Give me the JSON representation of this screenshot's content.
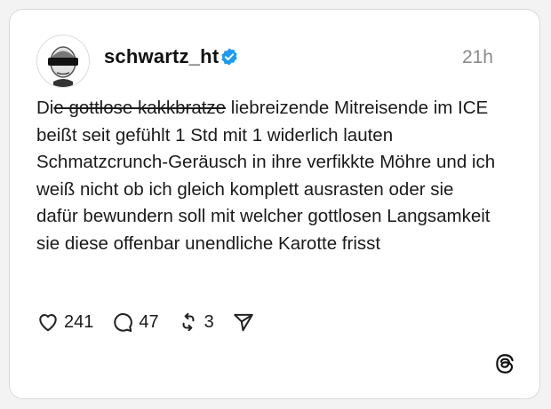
{
  "post": {
    "username": "schwartz_ht",
    "timestamp": "21h",
    "text_start": "Di",
    "text_struck": "e gottlose kakkbratze",
    "text_rest": " liebreizende Mitreisende im ICE beißt seit gefühlt 1 Std mit 1 widerlich lauten Schmatzcrunch-Geräusch in ihre verfikkte Möhre und ich weiß nicht ob ich gleich komplett ausrasten oder sie dafür bewundern soll mit welcher gottlosen Langsamkeit sie diese offenbar unendliche Karotte frisst"
  },
  "actions": {
    "likes": "241",
    "replies": "47",
    "reposts": "3"
  },
  "icons": {
    "verified": "verified-badge-icon",
    "like": "heart-icon",
    "reply": "comment-bubble-icon",
    "repost": "repost-icon",
    "share": "send-icon",
    "brand": "threads-logo-icon"
  },
  "colors": {
    "verified_blue": "#1d9bf0",
    "timestamp_gray": "#8a8a8a",
    "text": "#1a1a1a"
  }
}
